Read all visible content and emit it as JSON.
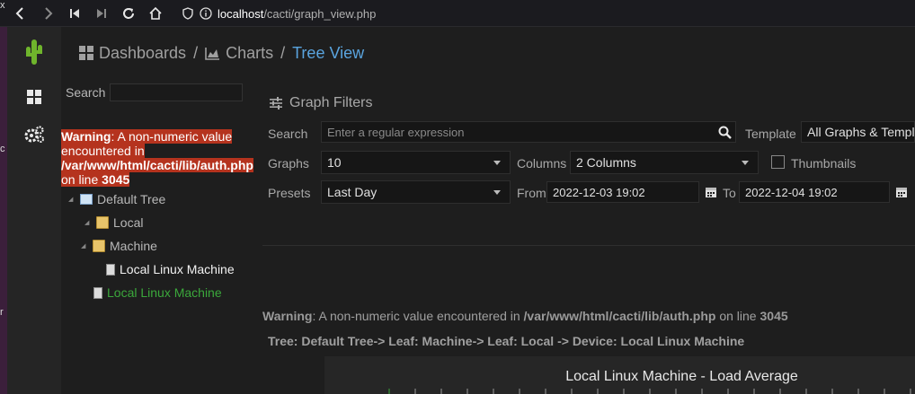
{
  "browser": {
    "url_host": "localhost",
    "url_path": "/cacti/graph_view.php"
  },
  "header": {
    "crumbs": [
      "Dashboards",
      "Charts",
      "Tree View"
    ],
    "separator": "/"
  },
  "tree_panel": {
    "search_label": "Search",
    "warning": {
      "label": "Warning",
      "message": ": A non-numeric value encountered in",
      "path": "/var/www/html/cacti/lib/auth.php",
      "line_prefix": "on line",
      "line_number": "3045"
    },
    "nodes": [
      "Default Tree",
      "Local",
      "Machine",
      "Local Linux Machine",
      "Local Linux Machine"
    ]
  },
  "filters": {
    "title": "Graph Filters",
    "search_label": "Search",
    "search_placeholder": "Enter a regular expression",
    "template_label": "Template",
    "template_value": "All Graphs & Templ",
    "graphs_label": "Graphs",
    "graphs_value": "10",
    "columns_label": "Columns",
    "columns_value": "2 Columns",
    "thumbnails_label": "Thumbnails",
    "presets_label": "Presets",
    "presets_value": "Last Day",
    "from_label": "From",
    "from_value": "2022-12-03 19:02",
    "to_label": "To",
    "to_value": "2022-12-04 19:02"
  },
  "content": {
    "warning_label": "Warning",
    "warning_message": ": A non-numeric value encountered in ",
    "warning_path": "/var/www/html/cacti/lib/auth.php",
    "warning_line_prefix": " on line ",
    "warning_line": "3045",
    "tree_path": "Tree: Default Tree-> Leaf: Machine-> Leaf: Local -> Device: Local Linux Machine",
    "graph_title": "Local Linux Machine - Load Average"
  },
  "colors": {
    "accent": "#5aa4de",
    "warning_bg": "#b5331e",
    "selected_node": "#3ba83b",
    "cactus": "#6fb52c"
  }
}
